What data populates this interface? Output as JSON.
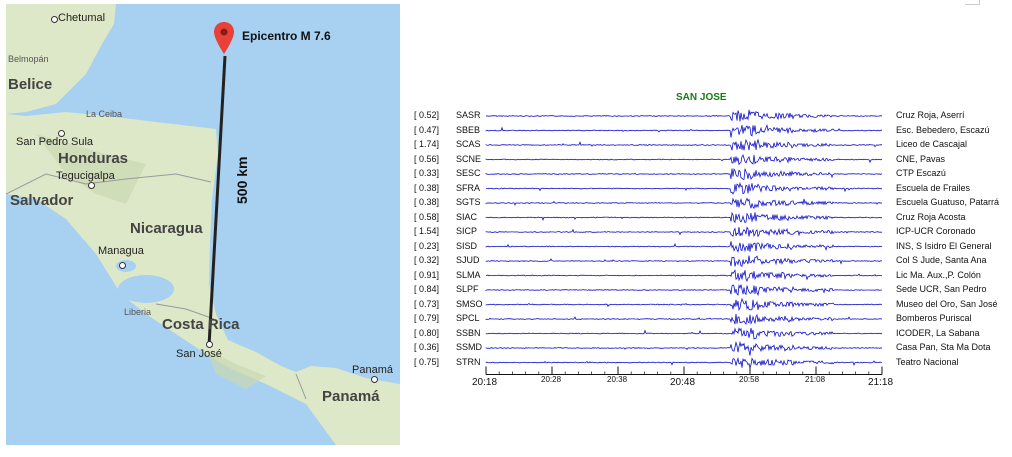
{
  "map": {
    "countries": [
      "Belice",
      "Honduras",
      "Salvador",
      "Nicaragua",
      "Costa Rica",
      "Panamá"
    ],
    "cities": [
      "Chetumal",
      "Belmopán",
      "La Ceiba",
      "San Pedro Sula",
      "Tegucigalpa",
      "Managua",
      "Liberia",
      "San José",
      "Panamá"
    ],
    "epicenter_label": "Epicentro M 7.6",
    "distance_label": "500 km",
    "colors": {
      "water": "#a8d0f0",
      "land": "#dde8c8",
      "pin": "#e8413a",
      "line": "#222222"
    }
  },
  "seismogram": {
    "title": "SAN JOSE",
    "trace_color": "#1010c8",
    "stations": [
      {
        "gain": "[  0.52]",
        "code": "SASR",
        "name": "Cruz Roja, Aserrí"
      },
      {
        "gain": "[  0.47]",
        "code": "SBEB",
        "name": "Esc. Bebedero, Escazú"
      },
      {
        "gain": "[  1.74]",
        "code": "SCAS",
        "name": "Liceo de Cascajal"
      },
      {
        "gain": "[  0.56]",
        "code": "SCNE",
        "name": "CNE, Pavas"
      },
      {
        "gain": "[  0.33]",
        "code": "SESC",
        "name": "CTP Escazú"
      },
      {
        "gain": "[  0.38]",
        "code": "SFRA",
        "name": "Escuela de Frailes"
      },
      {
        "gain": "[  0.38]",
        "code": "SGTS",
        "name": "Escuela Guatuso, Patarrá"
      },
      {
        "gain": "[  0.58]",
        "code": "SIAC",
        "name": "Cruz Roja Acosta"
      },
      {
        "gain": "[  1.54]",
        "code": "SICP",
        "name": "ICP-UCR Coronado"
      },
      {
        "gain": "[  0.23]",
        "code": "SISD",
        "name": "INS, S Isidro El General"
      },
      {
        "gain": "[  0.32]",
        "code": "SJUD",
        "name": "Col S Jude, Santa Ana"
      },
      {
        "gain": "[  0.91]",
        "code": "SLMA",
        "name": "Lic Ma. Aux.,P. Colón"
      },
      {
        "gain": "[  0.84]",
        "code": "SLPF",
        "name": "Sede UCR, San Pedro"
      },
      {
        "gain": "[  0.73]",
        "code": "SMSO",
        "name": "Museo del Oro, San José"
      },
      {
        "gain": "[  0.79]",
        "code": "SPCL",
        "name": "Bomberos Puriscal"
      },
      {
        "gain": "[  0.80]",
        "code": "SSBN",
        "name": "ICODER, La Sabana"
      },
      {
        "gain": "[  0.36]",
        "code": "SSMD",
        "name": "Casa Pan, Sta Ma Dota"
      },
      {
        "gain": "[  0.75]",
        "code": "STRN",
        "name": "Teatro Nacional"
      }
    ],
    "time_ticks_major": [
      "20:18",
      "20:48",
      "21:18"
    ],
    "time_ticks_minor": [
      "20:28",
      "20:38",
      "20:58",
      "21:08"
    ]
  }
}
